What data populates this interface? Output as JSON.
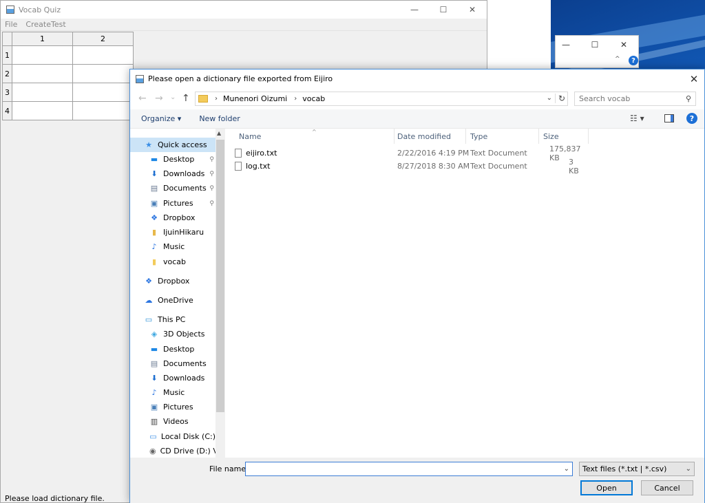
{
  "main_window": {
    "title": "Vocab Quiz",
    "menu": [
      "File",
      "CreateTest"
    ],
    "grid": {
      "columns": [
        "1",
        "2"
      ],
      "rows": [
        "1",
        "2",
        "3",
        "4"
      ]
    },
    "status": "Please load dictionary file."
  },
  "window_controls": {
    "minimize": "—",
    "maximize": "☐",
    "close": "✕"
  },
  "dialog": {
    "title": "Please open a dictionary file exported from Eijiro",
    "close": "✕",
    "nav": {
      "back": "←",
      "forward": "→",
      "recent": "⌄",
      "up": "↑"
    },
    "breadcrumb": [
      "Munenori Oizumi",
      "vocab"
    ],
    "breadcrumb_sep": "›",
    "search_placeholder": "Search vocab",
    "toolbar": {
      "organize": "Organize ▾",
      "new_folder": "New folder",
      "view": "☷ ▾",
      "help": "?"
    },
    "nav_items": [
      {
        "label": "Quick access",
        "icon": "star-icon",
        "glyph": "★",
        "color": "#3a8ee6"
      },
      {
        "label": "Desktop",
        "icon": "desktop-icon",
        "glyph": "▬",
        "color": "#1e88e5",
        "pin": "📌"
      },
      {
        "label": "Downloads",
        "icon": "download-icon",
        "glyph": "⬇",
        "color": "#1e6fd0",
        "pin": "📌"
      },
      {
        "label": "Documents",
        "icon": "document-icon",
        "glyph": "▤",
        "color": "#6c7c94",
        "pin": "📌"
      },
      {
        "label": "Pictures",
        "icon": "pictures-icon",
        "glyph": "▣",
        "color": "#4a7fb8",
        "pin": "📌"
      },
      {
        "label": "Dropbox",
        "icon": "dropbox-icon",
        "glyph": "❖",
        "color": "#2a74e0"
      },
      {
        "label": "IjuinHikaru",
        "icon": "folder-user-icon",
        "glyph": "▮",
        "color": "#e8b84a"
      },
      {
        "label": "Music",
        "icon": "music-icon",
        "glyph": "♪",
        "color": "#2a74e0"
      },
      {
        "label": "vocab",
        "icon": "folder-icon",
        "glyph": "▮",
        "color": "#f3cb5b"
      },
      {
        "label": "Dropbox",
        "icon": "dropbox-icon",
        "glyph": "❖",
        "color": "#2a74e0"
      },
      {
        "label": "OneDrive",
        "icon": "cloud-icon",
        "glyph": "☁",
        "color": "#2a74e0"
      },
      {
        "label": "This PC",
        "icon": "computer-icon",
        "glyph": "▭",
        "color": "#2a8fd6"
      },
      {
        "label": "3D Objects",
        "icon": "cube-icon",
        "glyph": "◈",
        "color": "#3aa6e0"
      },
      {
        "label": "Desktop",
        "icon": "desktop-icon",
        "glyph": "▬",
        "color": "#1e88e5"
      },
      {
        "label": "Documents",
        "icon": "document-icon",
        "glyph": "▤",
        "color": "#6c7c94"
      },
      {
        "label": "Downloads",
        "icon": "download-icon",
        "glyph": "⬇",
        "color": "#1e6fd0"
      },
      {
        "label": "Music",
        "icon": "music-icon",
        "glyph": "♪",
        "color": "#2a74e0"
      },
      {
        "label": "Pictures",
        "icon": "pictures-icon",
        "glyph": "▣",
        "color": "#4a7fb8"
      },
      {
        "label": "Videos",
        "icon": "video-icon",
        "glyph": "▥",
        "color": "#444"
      },
      {
        "label": "Local Disk (C:)",
        "icon": "disk-icon",
        "glyph": "▭",
        "color": "#3a8ee6"
      },
      {
        "label": "CD Drive (D:) Vir",
        "icon": "cd-icon",
        "glyph": "◉",
        "color": "#666"
      }
    ],
    "columns": [
      "Name",
      "Date modified",
      "Type",
      "Size"
    ],
    "files": [
      {
        "name": "eijiro.txt",
        "date": "2/22/2016 4:19 PM",
        "type": "Text Document",
        "size": "175,837 KB"
      },
      {
        "name": "log.txt",
        "date": "8/27/2018 8:30 AM",
        "type": "Text Document",
        "size": "3 KB"
      }
    ],
    "file_name_label": "File name:",
    "file_name_value": "",
    "file_type": "Text files (*.txt | *.csv)",
    "open_label": "Open",
    "cancel_label": "Cancel"
  },
  "background_window": {
    "help": "?",
    "caret": "^"
  }
}
